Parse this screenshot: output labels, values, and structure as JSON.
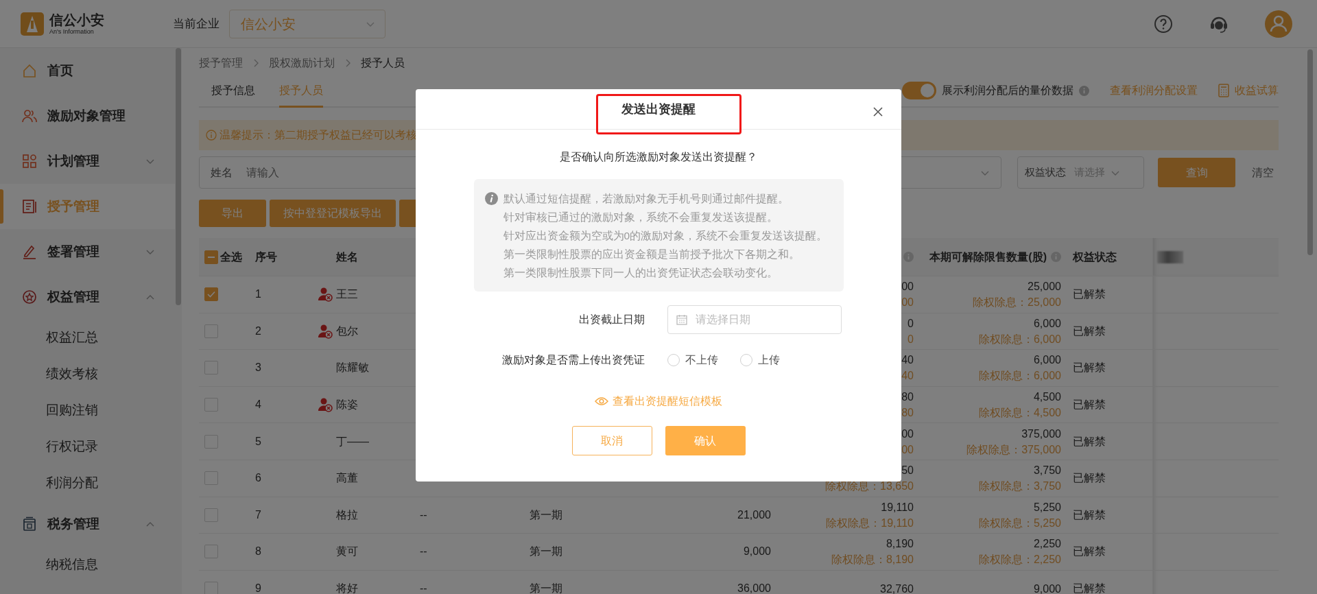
{
  "header": {
    "logo": {
      "name": "信公小安",
      "subtitle": "An's Information"
    },
    "company_label": "当前企业",
    "company_select": "信公小安"
  },
  "sidebar": {
    "items": [
      {
        "label": "首页",
        "selected": false
      },
      {
        "label": "激励对象管理",
        "selected": false
      },
      {
        "label": "计划管理",
        "selected": false,
        "expanded": false
      },
      {
        "label": "授予管理",
        "selected": true
      },
      {
        "label": "签署管理",
        "selected": false,
        "expanded": false
      },
      {
        "label": "权益管理",
        "selected": false,
        "expanded": true,
        "children": [
          {
            "label": "权益汇总",
            "selected": false
          },
          {
            "label": "绩效考核",
            "selected": false
          },
          {
            "label": "回购注销",
            "selected": false
          },
          {
            "label": "行权记录",
            "selected": false
          },
          {
            "label": "利润分配",
            "selected": false
          }
        ]
      },
      {
        "label": "税务管理",
        "selected": false,
        "expanded": true,
        "children": [
          {
            "label": "纳税信息",
            "selected": false
          }
        ]
      }
    ]
  },
  "breadcrumb": [
    "授予管理",
    "股权激励计划",
    "授予人员"
  ],
  "tabs": [
    {
      "label": "授予信息",
      "selected": false
    },
    {
      "label": "授予人员",
      "selected": true
    }
  ],
  "profit_toggle": {
    "on": true,
    "label": "展示利润分配后的量价数据"
  },
  "links": [
    {
      "kind": "link",
      "label": "查看利润分配设置"
    },
    {
      "kind": "calculator",
      "label": "收益试算"
    }
  ],
  "notice": "温馨提示：第二期授予权益已经可以考核",
  "filters": {
    "name": {
      "label": "姓名",
      "placeholder": "请输入"
    },
    "status": {
      "label": "权益状态",
      "placeholder": "请选择"
    },
    "query_button": "查询",
    "clear_button": "清空"
  },
  "actions": [
    "导出",
    "按中登登记模板导出"
  ],
  "table": {
    "select_all": {
      "label": "全选",
      "indeterminate": true
    },
    "columns": {
      "index": "序号",
      "name": "姓名",
      "unlock": "本期可解除限售数量(股)",
      "status": "权益状态"
    },
    "rows": [
      {
        "checked": true,
        "index": "1",
        "name": "王三",
        "flagged": true,
        "column_7": {
          "value": "00",
          "sub": "00"
        },
        "unlock": {
          "value": "25,000",
          "sub": "除权除息：25,000"
        },
        "status": "已解禁"
      },
      {
        "checked": false,
        "index": "2",
        "name": "包尔",
        "flagged": true,
        "column_7": {
          "value": "0",
          "sub": "0"
        },
        "unlock": {
          "value": "6,000",
          "sub": "除权除息：6,000"
        },
        "status": "已解禁"
      },
      {
        "checked": false,
        "index": "3",
        "name": "陈耀敏",
        "flagged": false,
        "column_7": {
          "value": "40",
          "sub": "40"
        },
        "unlock": {
          "value": "6,000",
          "sub": "除权除息：6,000"
        },
        "status": "已解禁"
      },
      {
        "checked": false,
        "index": "4",
        "name": "陈姿",
        "flagged": true,
        "column_7": {
          "value": "80",
          "sub": "80"
        },
        "unlock": {
          "value": "4,500",
          "sub": "除权除息：4,500"
        },
        "status": "已解禁"
      },
      {
        "checked": false,
        "index": "5",
        "name": "丁——",
        "flagged": false,
        "column_7": {
          "value": "00",
          "sub": "00"
        },
        "unlock": {
          "value": "375,000",
          "sub": "除权除息：375,000"
        },
        "status": "已解禁"
      },
      {
        "checked": false,
        "index": "6",
        "name": "高董",
        "flagged": false,
        "column_7": {
          "value": "50",
          "sub": "除权除息：13,650"
        },
        "unlock": {
          "value": "3,750",
          "sub": "除权除息：3,750"
        },
        "status": "已解禁"
      },
      {
        "checked": false,
        "index": "7",
        "name": "格拉",
        "flagged": false,
        "column_4": "--",
        "column_5": "第一期",
        "column_6": "21,000",
        "column_7": {
          "value": "19,110",
          "sub": "除权除息：19,110"
        },
        "unlock": {
          "value": "5,250",
          "sub": "除权除息：5,250"
        },
        "status": "已解禁"
      },
      {
        "checked": false,
        "index": "8",
        "name": "黄可",
        "flagged": false,
        "column_4": "--",
        "column_5": "第一期",
        "column_6": "9,000",
        "column_7": {
          "value": "8,190",
          "sub": "除权除息：8,190"
        },
        "unlock": {
          "value": "2,250",
          "sub": "除权除息：2,250"
        },
        "status": "已解禁"
      },
      {
        "checked": false,
        "index": "9",
        "name": "将好",
        "flagged": false,
        "column_4": "--",
        "column_5": "第一期",
        "column_6": "36,000",
        "column_7": {
          "value": "32,760"
        },
        "unlock": {
          "value": "9,000"
        },
        "status": "已解禁"
      }
    ]
  },
  "dialog": {
    "title": "发送出资提醒",
    "question": "是否确认向所选激励对象发送出资提醒？",
    "notes": [
      "默认通过短信提醒，若激励对象无手机号则通过邮件提醒。",
      "针对审核已通过的激励对象，系统不会重复发送该提醒。",
      "针对应出资金额为空或为0的激励对象，系统不会重复发送该提醒。",
      "第一类限制性股票的应出资金额是当前授予批次下各期之和。",
      "第一类限制性股票下同一人的出资凭证状态会联动变化。"
    ],
    "deadline": {
      "label": "出资截止日期",
      "placeholder": "请选择日期"
    },
    "upload": {
      "label": "激励对象是否需上传出资凭证",
      "options": [
        {
          "label": "不上传",
          "selected": false
        },
        {
          "label": "上传",
          "selected": false
        }
      ]
    },
    "template_link": "查看出资提醒短信模板",
    "cancel": "取消",
    "confirm": "确认"
  }
}
